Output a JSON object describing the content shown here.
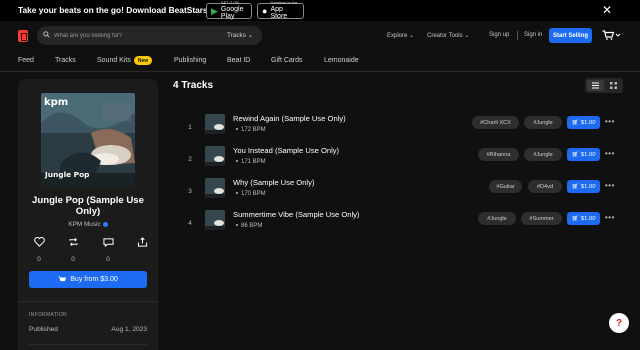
{
  "promo": {
    "text": "Take your beats on the go! Download BeatStars App",
    "google_play_small": "GET IT ON",
    "google_play_big": "Google Play",
    "app_store_small": "Download on the",
    "app_store_big": "App Store"
  },
  "header": {
    "search_placeholder": "What are you looking for?",
    "search_scope": "Tracks",
    "explore": "Explore",
    "creator_tools": "Creator Tools",
    "sign_up": "Sign up",
    "sign_in": "Sign in",
    "start_selling": "Start Selling"
  },
  "subnav": {
    "items": [
      "Feed",
      "Tracks",
      "Sound Kits",
      "Publishing",
      "Beat ID",
      "Gift Cards",
      "Lemonaide"
    ],
    "new_badge": "New"
  },
  "album": {
    "cover_text": "Jungle Pop",
    "cover_brand": "kpm",
    "title": "Jungle Pop (Sample Use Only)",
    "artist": "KPM Music",
    "likes": "0",
    "reposts": "0",
    "comments": "0",
    "buy_label": "Buy from $3.00",
    "info_label": "INFORMATION",
    "published_label": "Published",
    "published_date": "Aug 1, 2023"
  },
  "tracks": {
    "heading": "4 Tracks",
    "items": [
      {
        "num": "1",
        "title": "Rewind Again (Sample Use Only)",
        "bpm": "172 BPM",
        "tags": [
          "#Charli XCX",
          "#Jungle"
        ],
        "price": "$1.00"
      },
      {
        "num": "2",
        "title": "You Instead (Sample Use Only)",
        "bpm": "171 BPM",
        "tags": [
          "#Rihanna",
          "#Jungle"
        ],
        "price": "$1.00"
      },
      {
        "num": "3",
        "title": "Why (Sample Use Only)",
        "bpm": "170 BPM",
        "tags": [
          "#Guitar",
          "#D4vd"
        ],
        "price": "$1.00"
      },
      {
        "num": "4",
        "title": "Summertime Vibe (Sample Use Only)",
        "bpm": "86 BPM",
        "tags": [
          "#Jungle",
          "#Summer"
        ],
        "price": "$1.00"
      }
    ]
  },
  "help": "?",
  "colors": {
    "accent": "#1c6bf1",
    "logo": "#ff3b30",
    "badge": "#ffc907",
    "background": "#101010"
  }
}
